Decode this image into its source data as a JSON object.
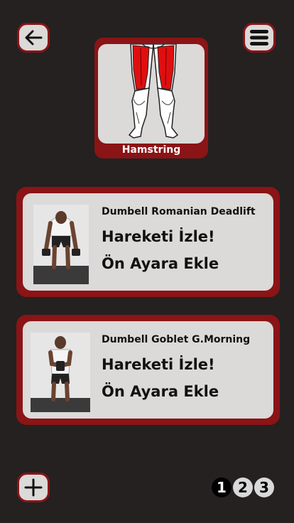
{
  "header": {
    "back_icon": "arrow-left-icon",
    "menu_icon": "hamburger-menu-icon"
  },
  "muscle": {
    "label": "Hamstring",
    "highlight_color": "#e00f0f"
  },
  "exercises": [
    {
      "name": "Dumbell Romanian Deadlift",
      "watch_label": "Hareketi İzle!",
      "preset_label": "Ön Ayara Ekle"
    },
    {
      "name": "Dumbell Goblet G.Morning",
      "watch_label": "Hareketi İzle!",
      "preset_label": "Ön Ayara Ekle"
    }
  ],
  "footer": {
    "add_icon": "plus-icon",
    "pages": [
      "1",
      "2",
      "3"
    ],
    "active_page": "1"
  },
  "colors": {
    "background": "#242120",
    "accent": "#8a1416",
    "card": "#dcd9d9"
  }
}
